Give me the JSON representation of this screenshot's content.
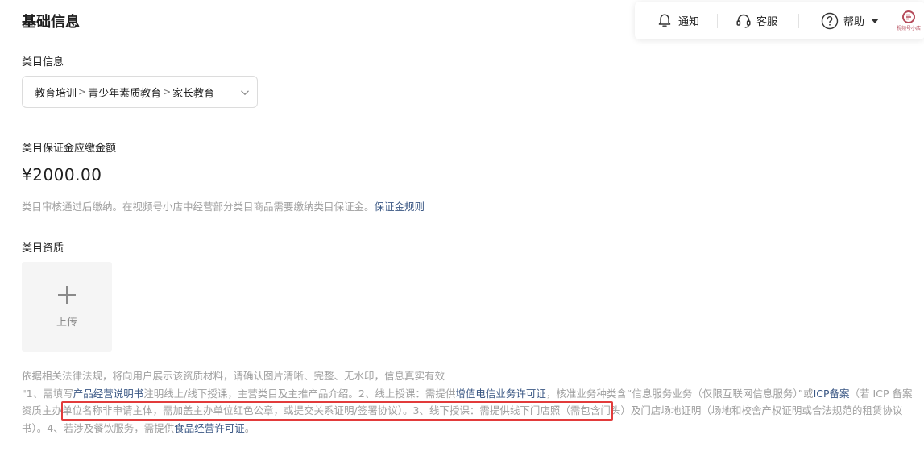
{
  "page": {
    "title": "基础信息"
  },
  "topbar": {
    "notify_label": "通知",
    "service_label": "客服",
    "help_label": "帮助",
    "logo_text": "视频号小店",
    "icons": {
      "notify": "bell-icon",
      "service": "headset-icon",
      "help": "question-circle-icon",
      "help_menu": "caret-down-icon",
      "logo": "brand-logo"
    }
  },
  "category": {
    "label": "类目信息",
    "path": [
      "教育培训",
      "青少年素质教育",
      "家长教育"
    ],
    "separator": ">",
    "icon": "chevron-down-icon"
  },
  "deposit": {
    "label": "类目保证金应缴金额",
    "amount": "¥2000.00",
    "hint_text": "类目审核通过后缴纳。在视频号小店中经营部分类目商品需要缴纳类目保证金。",
    "hint_link": "保证金规则"
  },
  "qualification": {
    "label": "类目资质",
    "upload_label": "上传",
    "upload_icon": "plus-icon",
    "notes": {
      "line1": "依据相关法律法规，将向用户展示该资质材料，请确认图片清晰、完整、无水印，信息真实有效",
      "p1": "\"1、需填写",
      "link1": "产品经营说明书",
      "p2": "注明线上/线下授课，主营类目及主推产品介绍。2、线上授课：需提供",
      "link2": "增值电信业务许可证",
      "p3": "，核准业务种类含“信息服务业务（仅限互联网信息服务）”或",
      "link3": "ICP备案",
      "p4": "（若 ICP 备案资质主办单位名称非申请主体，需加盖主办单位红色公章，或提交关系证明/签署协议）。3、线下授课：需提供线下门店照（需包含门头）及门店场地证明（场地和校舍产权证明或合法规范的租赁协议书）。4、若涉及餐饮服务，需提供",
      "link4": "食品经营许可证",
      "p5": "。"
    }
  },
  "colors": {
    "link": "#3a5784",
    "hint": "#a0a0a0",
    "highlight_box": "#e23b3b",
    "logo": "#b54a5a"
  }
}
